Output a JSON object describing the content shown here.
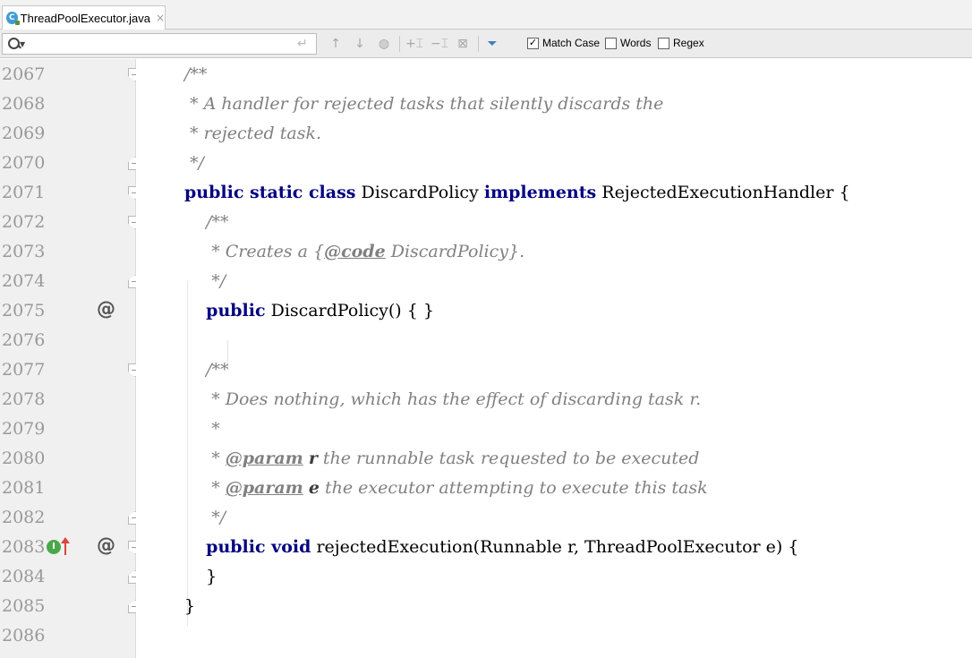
{
  "tab": {
    "icon": "class-icon",
    "label": "ThreadPoolExecutor.java",
    "close": "×"
  },
  "find": {
    "value": "",
    "options": [
      {
        "label": "Match Case",
        "checked": true
      },
      {
        "label": "Words",
        "checked": false
      },
      {
        "label": "Regex",
        "checked": false
      }
    ]
  },
  "gutter": {
    "lines": [
      "2067",
      "2068",
      "2069",
      "2070",
      "2071",
      "2072",
      "2073",
      "2074",
      "2075",
      "2076",
      "2077",
      "2078",
      "2079",
      "2080",
      "2081",
      "2082",
      "2083",
      "2084",
      "2085",
      "2086"
    ],
    "at_symbol": "@",
    "impl_symbol": "I"
  },
  "code": [
    {
      "parts": [
        {
          "t": "/**",
          "c": "cmt"
        }
      ]
    },
    {
      "parts": [
        {
          "t": " * A handler for rejected tasks that silently discards the",
          "c": "cmt"
        }
      ]
    },
    {
      "parts": [
        {
          "t": " * rejected task.",
          "c": "cmt"
        }
      ]
    },
    {
      "parts": [
        {
          "t": " */",
          "c": "cmt"
        }
      ]
    },
    {
      "parts": [
        {
          "t": "public static class",
          "c": "kw"
        },
        {
          "t": " DiscardPolicy ",
          "c": ""
        },
        {
          "t": "implements",
          "c": "kw"
        },
        {
          "t": " RejectedExecutionHandler {",
          "c": ""
        }
      ]
    },
    {
      "parts": [
        {
          "t": "    /**",
          "c": "cmt"
        }
      ]
    },
    {
      "parts": [
        {
          "t": "     * Creates a {",
          "c": "cmt"
        },
        {
          "t": "@code",
          "c": "tag"
        },
        {
          "t": " DiscardPolicy}.",
          "c": "cmt"
        }
      ]
    },
    {
      "parts": [
        {
          "t": "     */",
          "c": "cmt"
        }
      ]
    },
    {
      "parts": [
        {
          "t": "    ",
          "c": ""
        },
        {
          "t": "public",
          "c": "kw"
        },
        {
          "t": " DiscardPolicy() { }",
          "c": ""
        }
      ]
    },
    {
      "parts": [
        {
          "t": "",
          "c": ""
        }
      ]
    },
    {
      "parts": [
        {
          "t": "    /**",
          "c": "cmt"
        }
      ]
    },
    {
      "parts": [
        {
          "t": "     * Does nothing, which has the effect of discarding task r.",
          "c": "cmt"
        }
      ]
    },
    {
      "parts": [
        {
          "t": "     *",
          "c": "cmt"
        }
      ]
    },
    {
      "parts": [
        {
          "t": "     * ",
          "c": "cmt"
        },
        {
          "t": "@param",
          "c": "tag"
        },
        {
          "t": " ",
          "c": "cmt"
        },
        {
          "t": "r",
          "c": "pname"
        },
        {
          "t": " the runnable task requested to be executed",
          "c": "cmt"
        }
      ]
    },
    {
      "parts": [
        {
          "t": "     * ",
          "c": "cmt"
        },
        {
          "t": "@param",
          "c": "tag"
        },
        {
          "t": " ",
          "c": "cmt"
        },
        {
          "t": "e",
          "c": "pname"
        },
        {
          "t": " the executor attempting to execute this task",
          "c": "cmt"
        }
      ]
    },
    {
      "parts": [
        {
          "t": "     */",
          "c": "cmt"
        }
      ]
    },
    {
      "parts": [
        {
          "t": "    ",
          "c": ""
        },
        {
          "t": "public void",
          "c": "kw"
        },
        {
          "t": " rejectedExecution(Runnable r, ThreadPoolExecutor e) {",
          "c": ""
        }
      ]
    },
    {
      "parts": [
        {
          "t": "    }",
          "c": ""
        }
      ]
    },
    {
      "parts": [
        {
          "t": "}",
          "c": ""
        }
      ]
    },
    {
      "parts": [
        {
          "t": "",
          "c": ""
        }
      ]
    }
  ]
}
